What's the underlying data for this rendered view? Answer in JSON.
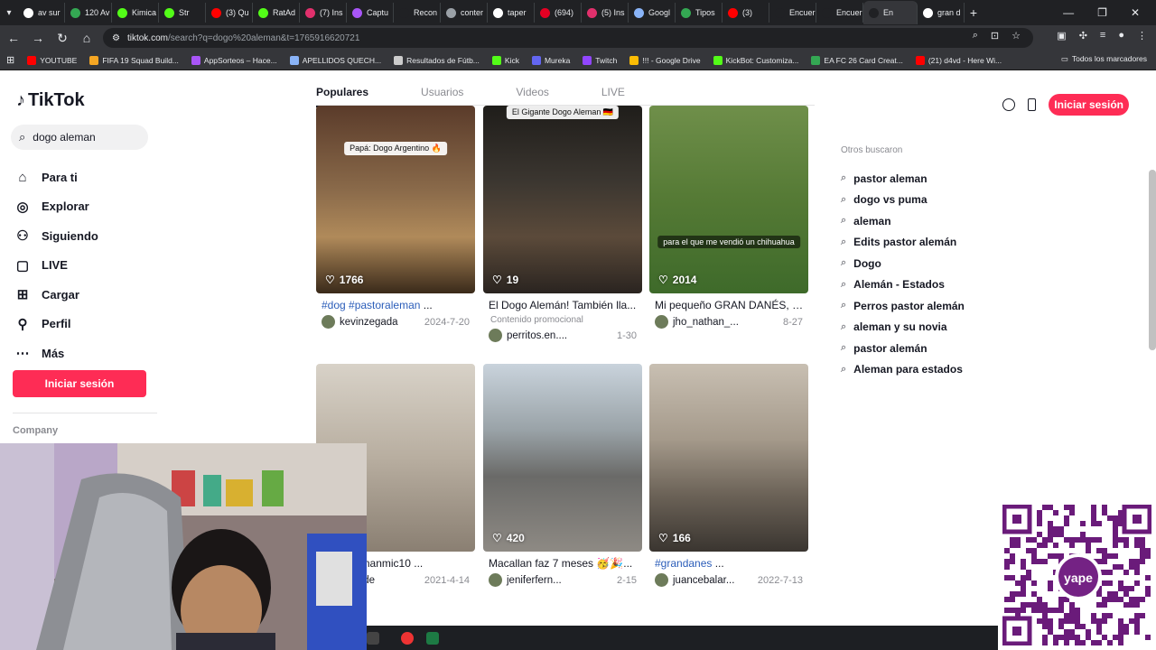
{
  "browser": {
    "tabs": [
      {
        "label": "av sur",
        "color": "#ffffff"
      },
      {
        "label": "120 Av",
        "color": "#34a853"
      },
      {
        "label": "Kimica",
        "color": "#53fc18"
      },
      {
        "label": "Str",
        "color": "#53fc18"
      },
      {
        "label": "(3) Qu",
        "color": "#ff0000"
      },
      {
        "label": "RatAd",
        "color": "#53fc18"
      },
      {
        "label": "(7) Ins",
        "color": "#e1306c"
      },
      {
        "label": "Captu",
        "color": "#a855f7"
      },
      {
        "label": "Recon",
        "color": "#202124"
      },
      {
        "label": "conter",
        "color": "#9aa0a6"
      },
      {
        "label": "taper",
        "color": "#ffffff"
      },
      {
        "label": "(694)",
        "color": "#e60023"
      },
      {
        "label": "(5) Ins",
        "color": "#e1306c"
      },
      {
        "label": "Googl",
        "color": "#8ab4f8"
      },
      {
        "label": "Tipos",
        "color": "#34a853"
      },
      {
        "label": "(3)",
        "color": "#ff0000"
      },
      {
        "label": "Encuer",
        "color": "#202124"
      },
      {
        "label": "Encuer",
        "color": "#202124"
      },
      {
        "label": "En",
        "color": "#202124"
      },
      {
        "label": "gran d",
        "color": "#ffffff"
      }
    ],
    "new_tab": "+",
    "url_host": "tiktok.com",
    "url_rest": "/search?q=dogo%20aleman&t=1765916620721",
    "bookmarks": [
      {
        "label": "YOUTUBE",
        "color": "#ff0000"
      },
      {
        "label": "FIFA 19 Squad Build...",
        "color": "#f5a623"
      },
      {
        "label": "AppSorteos – Hace...",
        "color": "#a855f7"
      },
      {
        "label": "APELLIDOS QUECH...",
        "color": "#8ab4f8"
      },
      {
        "label": "Resultados de Fútb...",
        "color": "#cccccc"
      },
      {
        "label": "Kick",
        "color": "#53fc18"
      },
      {
        "label": "Mureka",
        "color": "#6366f1"
      },
      {
        "label": "Twitch",
        "color": "#9146ff"
      },
      {
        "label": "!!! - Google Drive",
        "color": "#fbbc04"
      },
      {
        "label": "KickBot: Customiza...",
        "color": "#53fc18"
      },
      {
        "label": "EA FC 26 Card Creat...",
        "color": "#34a853"
      },
      {
        "label": "(21) d4vd - Here Wi...",
        "color": "#ff0000"
      }
    ],
    "bookmarks_folder": "Todos los marcadores"
  },
  "tiktok": {
    "logo": "TikTok",
    "search_value": "dogo aleman",
    "nav": [
      {
        "label": "Para ti",
        "icon": "home-icon",
        "glyph": "⌂"
      },
      {
        "label": "Explorar",
        "icon": "compass-icon",
        "glyph": "◎"
      },
      {
        "label": "Siguiendo",
        "icon": "following-icon",
        "glyph": "⚇"
      },
      {
        "label": "LIVE",
        "icon": "live-icon",
        "glyph": "▢"
      },
      {
        "label": "Cargar",
        "icon": "upload-icon",
        "glyph": "⊞"
      },
      {
        "label": "Perfil",
        "icon": "profile-icon",
        "glyph": "⚲"
      },
      {
        "label": "Más",
        "icon": "more-icon",
        "glyph": "⋯"
      }
    ],
    "login_label": "Iniciar sesión",
    "company": "Company",
    "tabs": [
      "Populares",
      "Usuarios",
      "Videos",
      "LIVE"
    ],
    "videos": [
      {
        "likes": "1766",
        "tag": "#dog #pastoraleman",
        "desc": " ...",
        "user": "kevinzegada",
        "date": "2024-7-20",
        "promo": "",
        "bg": "linear-gradient(180deg,#5a3b2a 0%,#8a6a4a 45%,#b08a5a 70%,#3a2a1a 100%)",
        "caption": "Papá: Dogo Argentino 🔥"
      },
      {
        "likes": "19",
        "tag": "",
        "desc": "El Dogo Alemán! También lla...",
        "user": "perritos.en....",
        "date": "1-30",
        "promo": "Contenido promocional",
        "bg": "linear-gradient(180deg,#1f1d1a 0%,#3b3630 40%,#5b4a3a 70%,#2a2420 100%)",
        "caption": "El Gigante Dogo Aleman 🇩🇪"
      },
      {
        "likes": "2014",
        "tag": "",
        "desc": "Mi pequeño GRAN DANÉS, E...",
        "user": "jho_nathan_...",
        "date": "8-27",
        "promo": "",
        "bg": "linear-gradient(180deg,#6f8f4a 0%,#557a35 50%,#3e6a2a 100%)",
        "caption": "para el que me vendió un chihuahua"
      },
      {
        "likes": "",
        "tag": "",
        "desc": "er a @renanmic10 ...",
        "user": ".grande",
        "date": "2021-4-14",
        "promo": "",
        "bg": "linear-gradient(180deg,#d8d2c8 0%,#b8aea0 50%,#8a7f72 100%)",
        "caption": ""
      },
      {
        "likes": "420",
        "tag": "",
        "desc": "Macallan faz 7 meses 🥳🎉...",
        "user": "jeniferfern...",
        "date": "2-15",
        "promo": "",
        "bg": "linear-gradient(180deg,#c9d3dc 0%,#9aa3a8 35%,#6a6a68 60%,#8e8a84 100%)",
        "caption": ""
      },
      {
        "likes": "166",
        "tag": "#grandanes",
        "desc": " ...",
        "user": "juancebalar...",
        "date": "2022-7-13",
        "promo": "",
        "bg": "linear-gradient(180deg,#c8bfb2 0%,#a59a8b 40%,#6b6257 70%,#3a3530 100%)",
        "caption": ""
      }
    ],
    "others_title": "Otros buscaron",
    "others": [
      "pastor aleman",
      "dogo vs puma",
      "aleman",
      "Edits pastor alemán",
      "Dogo",
      "Alemán - Estados",
      "Perros pastor alemán",
      "aleman y su novia",
      "pastor alemán",
      "Aleman para estados"
    ],
    "qr_label": "yape"
  }
}
